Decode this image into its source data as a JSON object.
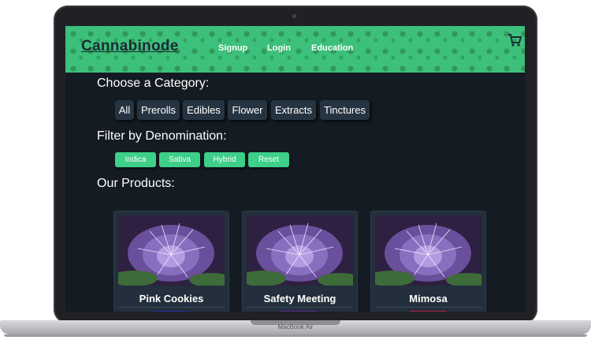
{
  "header": {
    "logo": "Cannabinode",
    "nav": [
      "Signup",
      "Login",
      "Education"
    ]
  },
  "categories": {
    "title": "Choose a Category:",
    "items": [
      "All",
      "Prerolls",
      "Edibles",
      "Flower",
      "Extracts",
      "Tinctures"
    ]
  },
  "filters": {
    "title": "Filter by Denomination:",
    "items": [
      "Indica",
      "Sativa",
      "Hybrid",
      "Reset"
    ]
  },
  "products": {
    "title": "Our Products:",
    "items": [
      {
        "name": "Pink Cookies",
        "tag_color": "#1f2fa0"
      },
      {
        "name": "Safety Meeting",
        "tag_color": "#5a2a8a"
      },
      {
        "name": "Mimosa",
        "tag_color": "#b0203a"
      }
    ]
  },
  "device": {
    "label": "MacBook Air"
  },
  "colors": {
    "accent": "#3ecf89",
    "background": "#141b22",
    "button": "#263442"
  }
}
